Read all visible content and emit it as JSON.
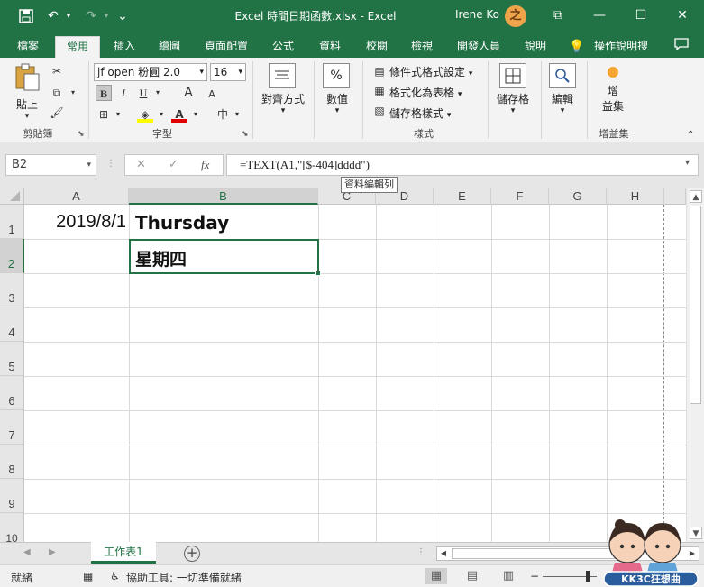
{
  "titlebar": {
    "title": "Excel 時間日期函數.xlsx  -  Excel",
    "user": "Irene Ko",
    "avatar_letter": "之",
    "save_icon": "💾",
    "undo_icon": "↶",
    "redo_icon": "↷",
    "customize_icon": "⌄",
    "ribbon_display_icon": "⧉",
    "minimize_icon": "—",
    "maximize_icon": "☐",
    "close_icon": "✕"
  },
  "tabs": [
    "檔案",
    "常用",
    "插入",
    "繪圖",
    "頁面配置",
    "公式",
    "資料",
    "校閱",
    "檢視",
    "開發人員",
    "說明"
  ],
  "tell_me": "操作說明搜",
  "ribbon": {
    "clipboard": {
      "paste_label": "貼上",
      "group_label": "剪貼簿"
    },
    "font": {
      "font_name": "jf open 粉圓 2.0",
      "font_size": "16",
      "bold": "B",
      "italic": "I",
      "underline": "U",
      "grow": "A",
      "shrink": "A",
      "font_color_letter": "A",
      "phonetic": "中",
      "group_label": "字型"
    },
    "alignment": {
      "label": "對齊方式"
    },
    "number": {
      "label": "數值",
      "icon_text": "%"
    },
    "styles": {
      "conditional": "條件式格式設定",
      "format_table": "格式化為表格",
      "cell_styles": "儲存格樣式",
      "group_label": "樣式"
    },
    "cells": {
      "label": "儲存格"
    },
    "editing": {
      "label": "編輯"
    },
    "addins": {
      "label_line1": "增",
      "label_line2": "益集",
      "group_label": "增益集"
    }
  },
  "formula_bar": {
    "name_box": "B2",
    "formula": "=TEXT(A1,\"[$-404]dddd\")",
    "cancel_icon": "✕",
    "enter_icon": "✓",
    "fx": "fx",
    "tooltip": "資料編輯列"
  },
  "grid": {
    "columns": [
      "A",
      "B",
      "C",
      "D",
      "E",
      "F",
      "G",
      "H"
    ],
    "rows": [
      "1",
      "2",
      "3",
      "4",
      "5",
      "6",
      "7",
      "8",
      "9",
      "10"
    ],
    "cells": {
      "A1": "2019/8/1",
      "B1": "Thursday",
      "B2": "星期四"
    },
    "selected_cell": "B2"
  },
  "sheets": [
    "工作表1"
  ],
  "status": {
    "ready": "就緒",
    "accessibility": "協助工具: 一切準備就緒"
  },
  "watermark": {
    "text": "KK3C狂想曲"
  },
  "colors": {
    "accent": "#217346",
    "ribbon_bg": "#f3f3f3"
  }
}
